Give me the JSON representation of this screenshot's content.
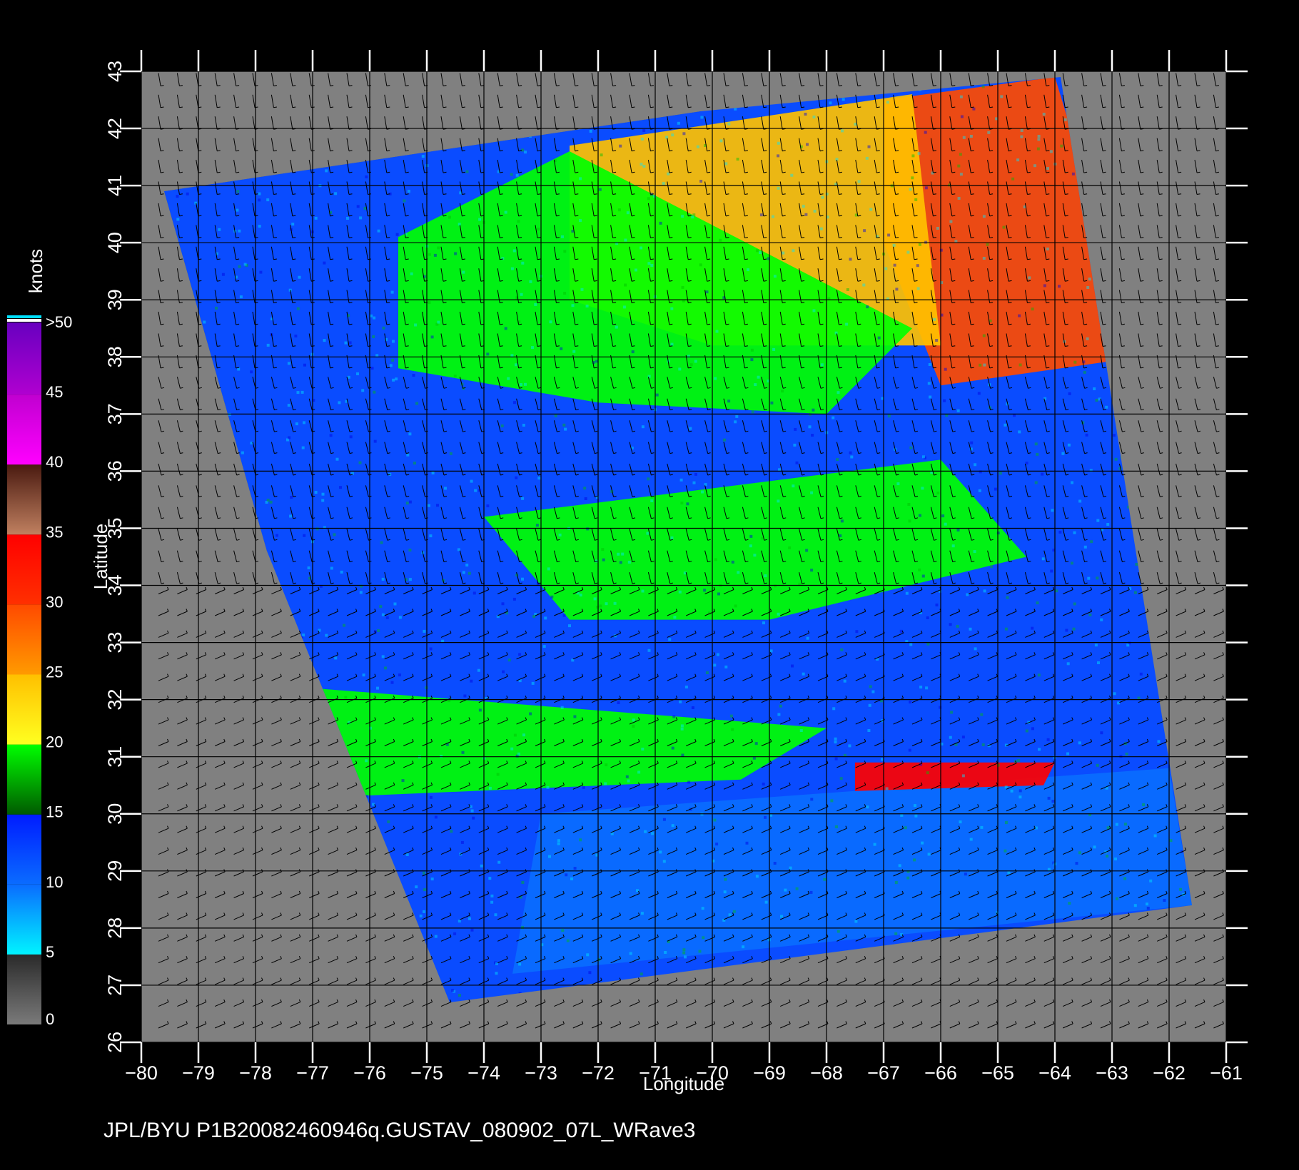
{
  "product_id": "JPL/BYU  P1B20082460946q.GUSTAV_080902_07L_WRave3",
  "map": {
    "xlabel": "Longitude",
    "ylabel": "Latitude",
    "lon_range": [
      -80,
      -61
    ],
    "lat_range": [
      26,
      43
    ],
    "lon_ticks": [
      "-80",
      "-79",
      "-78",
      "-77",
      "-76",
      "-75",
      "-74",
      "-73",
      "-72",
      "-71",
      "-70",
      "-69",
      "-68",
      "-67",
      "-66",
      "-65",
      "-64",
      "-63",
      "-62",
      "-61"
    ],
    "lat_ticks": [
      "26",
      "27",
      "28",
      "29",
      "30",
      "31",
      "32",
      "33",
      "34",
      "35",
      "36",
      "37",
      "38",
      "39",
      "40",
      "41",
      "42",
      "43"
    ],
    "grid": true,
    "background_color": "#808080"
  },
  "colorbar": {
    "unit": "knots",
    "labels": [
      "0",
      "5",
      "10",
      "15",
      "20",
      "25",
      "30",
      "35",
      "40",
      "45",
      ">50"
    ],
    "bands": [
      {
        "from": 0,
        "to": 5,
        "colors": [
          "#7a7a7a",
          "#2a2a2a"
        ]
      },
      {
        "from": 5,
        "to": 10,
        "colors": [
          "#00f4ff",
          "#0a6cff"
        ]
      },
      {
        "from": 10,
        "to": 15,
        "colors": [
          "#0a6cff",
          "#001cff"
        ]
      },
      {
        "from": 15,
        "to": 20,
        "colors": [
          "#005a00",
          "#00ff00"
        ]
      },
      {
        "from": 20,
        "to": 25,
        "colors": [
          "#ffff20",
          "#ffc000"
        ]
      },
      {
        "from": 25,
        "to": 30,
        "colors": [
          "#ff9a00",
          "#ff4a00"
        ]
      },
      {
        "from": 30,
        "to": 35,
        "colors": [
          "#ff3000",
          "#ff0000"
        ]
      },
      {
        "from": 35,
        "to": 40,
        "colors": [
          "#c08060",
          "#4a1a10"
        ]
      },
      {
        "from": 40,
        "to": 45,
        "colors": [
          "#ff00ff",
          "#c000d0"
        ]
      },
      {
        "from": 45,
        "to": 50,
        "colors": [
          "#b000d0",
          "#6a00c0"
        ]
      }
    ]
  },
  "wind_speed_field": {
    "swath_corners_lonlat": [
      [
        -79.6,
        40.9
      ],
      [
        -70.2,
        42.3
      ],
      [
        -63.9,
        42.9
      ],
      [
        -61.6,
        28.4
      ],
      [
        -74.6,
        26.7
      ],
      [
        -77.8,
        34.6
      ]
    ],
    "regions": [
      {
        "name": "north-east high winds",
        "speed_knots": 28,
        "lonlat": [
          [
            -67,
            42.5
          ],
          [
            -64,
            42.9
          ],
          [
            -62.5,
            38
          ],
          [
            -66,
            37.5
          ],
          [
            -67,
            40
          ]
        ]
      },
      {
        "name": "north yellow band",
        "speed_knots": 22,
        "lonlat": [
          [
            -72.5,
            41.7
          ],
          [
            -66.5,
            42.6
          ],
          [
            -66,
            38.2
          ],
          [
            -70,
            38.2
          ],
          [
            -72.5,
            39
          ]
        ]
      },
      {
        "name": "coastal green band",
        "speed_knots": 17,
        "lonlat": [
          [
            -75.5,
            40.1
          ],
          [
            -72.5,
            41.6
          ],
          [
            -66.5,
            38.5
          ],
          [
            -68,
            37
          ],
          [
            -72,
            37.2
          ],
          [
            -75.5,
            37.8
          ]
        ]
      },
      {
        "name": "central green patch",
        "speed_knots": 16,
        "lonlat": [
          [
            -74,
            35.2
          ],
          [
            -66,
            36.2
          ],
          [
            -64.5,
            34.5
          ],
          [
            -69,
            33.4
          ],
          [
            -72.5,
            33.4
          ]
        ]
      },
      {
        "name": "south green band",
        "speed_knots": 16,
        "lonlat": [
          [
            -77,
            32.2
          ],
          [
            -68,
            31.5
          ],
          [
            -69.5,
            30.6
          ],
          [
            -76.5,
            30.3
          ]
        ]
      },
      {
        "name": "southern light winds",
        "speed_knots": 7,
        "lonlat": [
          [
            -73,
            30
          ],
          [
            -62,
            30.8
          ],
          [
            -61.6,
            28.4
          ],
          [
            -73.5,
            27.2
          ]
        ]
      },
      {
        "name": "rain cells",
        "speed_knots": 32,
        "lonlat": [
          [
            -67.5,
            30.9
          ],
          [
            -64,
            30.9
          ],
          [
            -64.2,
            30.5
          ],
          [
            -67.5,
            30.4
          ]
        ]
      }
    ]
  }
}
